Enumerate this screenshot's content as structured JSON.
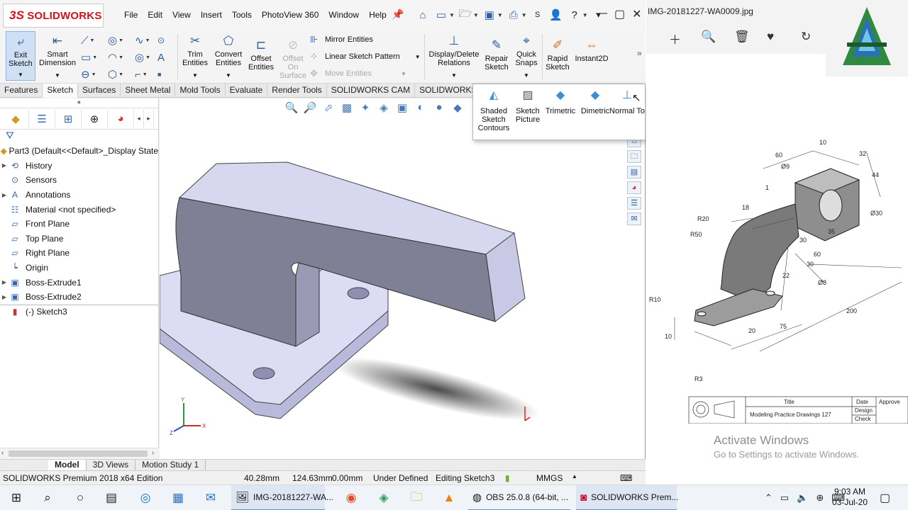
{
  "solidworks": {
    "logo_text": "SOLIDWORKS",
    "logo_ds": "3S",
    "menu": [
      "File",
      "Edit",
      "View",
      "Insert",
      "Tools",
      "PhotoView 360",
      "Window",
      "Help"
    ],
    "search_partial": "S",
    "help_q": "?",
    "ribbon": {
      "exit_sketch": "Exit Sketch",
      "smart_dimension": "Smart Dimension",
      "trim_entities": "Trim Entities",
      "convert_entities": "Convert Entities",
      "offset_entities": "Offset Entities",
      "offset_on_surface": "Offset On Surface",
      "mirror_entities": "Mirror Entities",
      "linear_sketch_pattern": "Linear Sketch Pattern",
      "move_entities": "Move Entities",
      "display_delete_relations": "Display/Delete Relations",
      "repair_sketch": "Repair Sketch",
      "quick_snaps": "Quick Snaps",
      "rapid_sketch": "Rapid Sketch",
      "instant2d": "Instant2D",
      "overflow": "»"
    },
    "tabs": [
      "Features",
      "Sketch",
      "Surfaces",
      "Sheet Metal",
      "Mold Tools",
      "Evaluate",
      "Render Tools",
      "SOLIDWORKS CAM",
      "SOLIDWORKS Visual"
    ],
    "active_tab": "Sketch",
    "flyout": [
      "Shaded Sketch Contours",
      "Sketch Picture",
      "Trimetric",
      "Dimetric",
      "Normal To"
    ],
    "tree": {
      "part": "Part3  (Default<<Default>_Display State",
      "items": [
        {
          "label": "History",
          "icon": "history-icon",
          "expand": true
        },
        {
          "label": "Sensors",
          "icon": "sensor-icon",
          "expand": false
        },
        {
          "label": "Annotations",
          "icon": "annotation-icon",
          "expand": true
        },
        {
          "label": "Material <not specified>",
          "icon": "material-icon",
          "expand": false
        },
        {
          "label": "Front Plane",
          "icon": "plane-icon",
          "expand": false
        },
        {
          "label": "Top Plane",
          "icon": "plane-icon",
          "expand": false
        },
        {
          "label": "Right Plane",
          "icon": "plane-icon",
          "expand": false
        },
        {
          "label": "Origin",
          "icon": "origin-icon",
          "expand": false
        },
        {
          "label": "Boss-Extrude1",
          "icon": "extrude-icon",
          "expand": true
        },
        {
          "label": "Boss-Extrude2",
          "icon": "extrude-icon",
          "expand": true
        },
        {
          "label": "(-) Sketch3",
          "icon": "sketch-icon",
          "expand": false
        }
      ]
    },
    "bottom_tabs": [
      "Model",
      "3D Views",
      "Motion Study 1"
    ],
    "active_bottom_tab": "Model",
    "status": {
      "edition": "SOLIDWORKS Premium 2018 x64 Edition",
      "x": "40.28mm",
      "y": "124.63mm",
      "z": "0.00mm",
      "state": "Under Defined",
      "editing": "Editing Sketch3",
      "units": "MMGS"
    }
  },
  "photos": {
    "title": "IMG-20181227-WA0009.jpg",
    "drawing": {
      "dims": [
        "60",
        "10",
        "32",
        "Ø9",
        "44",
        "Ø30",
        "R20",
        "18",
        "R50",
        "1",
        "35",
        "30",
        "60",
        "22",
        "30",
        "Ø8",
        "R10",
        "10",
        "20",
        "75",
        "200",
        "R3"
      ],
      "title_header": "Title",
      "title_value": "Modeling Practice Drawings 127",
      "date": "Date",
      "design": "Design",
      "check": "Check",
      "approve": "Approve"
    },
    "activate_title": "Activate Windows",
    "activate_sub": "Go to Settings to activate Windows."
  },
  "taskbar": {
    "apps": [
      {
        "label": "IMG-20181227-WA...",
        "icon": "photos-icon"
      },
      {
        "label": "OBS 25.0.8 (64-bit, ...",
        "icon": "obs-icon"
      },
      {
        "label": "SOLIDWORKS Prem...",
        "icon": "solidworks-icon"
      }
    ],
    "time": "9:03 AM",
    "date": "03-Jul-20"
  }
}
